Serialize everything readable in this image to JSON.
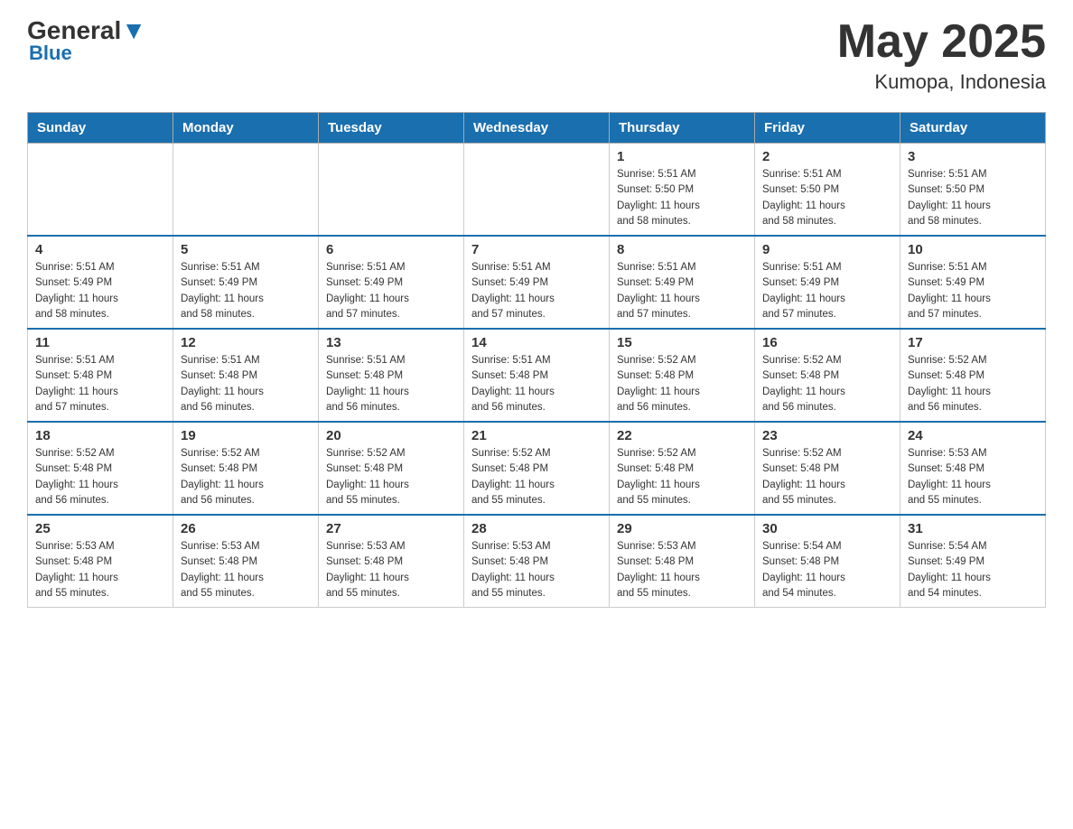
{
  "header": {
    "logo": {
      "general": "General",
      "blue": "Blue"
    },
    "title": "May 2025",
    "subtitle": "Kumopa, Indonesia"
  },
  "days_of_week": [
    "Sunday",
    "Monday",
    "Tuesday",
    "Wednesday",
    "Thursday",
    "Friday",
    "Saturday"
  ],
  "weeks": [
    [
      {
        "day": "",
        "info": ""
      },
      {
        "day": "",
        "info": ""
      },
      {
        "day": "",
        "info": ""
      },
      {
        "day": "",
        "info": ""
      },
      {
        "day": "1",
        "info": "Sunrise: 5:51 AM\nSunset: 5:50 PM\nDaylight: 11 hours\nand 58 minutes."
      },
      {
        "day": "2",
        "info": "Sunrise: 5:51 AM\nSunset: 5:50 PM\nDaylight: 11 hours\nand 58 minutes."
      },
      {
        "day": "3",
        "info": "Sunrise: 5:51 AM\nSunset: 5:50 PM\nDaylight: 11 hours\nand 58 minutes."
      }
    ],
    [
      {
        "day": "4",
        "info": "Sunrise: 5:51 AM\nSunset: 5:49 PM\nDaylight: 11 hours\nand 58 minutes."
      },
      {
        "day": "5",
        "info": "Sunrise: 5:51 AM\nSunset: 5:49 PM\nDaylight: 11 hours\nand 58 minutes."
      },
      {
        "day": "6",
        "info": "Sunrise: 5:51 AM\nSunset: 5:49 PM\nDaylight: 11 hours\nand 57 minutes."
      },
      {
        "day": "7",
        "info": "Sunrise: 5:51 AM\nSunset: 5:49 PM\nDaylight: 11 hours\nand 57 minutes."
      },
      {
        "day": "8",
        "info": "Sunrise: 5:51 AM\nSunset: 5:49 PM\nDaylight: 11 hours\nand 57 minutes."
      },
      {
        "day": "9",
        "info": "Sunrise: 5:51 AM\nSunset: 5:49 PM\nDaylight: 11 hours\nand 57 minutes."
      },
      {
        "day": "10",
        "info": "Sunrise: 5:51 AM\nSunset: 5:49 PM\nDaylight: 11 hours\nand 57 minutes."
      }
    ],
    [
      {
        "day": "11",
        "info": "Sunrise: 5:51 AM\nSunset: 5:48 PM\nDaylight: 11 hours\nand 57 minutes."
      },
      {
        "day": "12",
        "info": "Sunrise: 5:51 AM\nSunset: 5:48 PM\nDaylight: 11 hours\nand 56 minutes."
      },
      {
        "day": "13",
        "info": "Sunrise: 5:51 AM\nSunset: 5:48 PM\nDaylight: 11 hours\nand 56 minutes."
      },
      {
        "day": "14",
        "info": "Sunrise: 5:51 AM\nSunset: 5:48 PM\nDaylight: 11 hours\nand 56 minutes."
      },
      {
        "day": "15",
        "info": "Sunrise: 5:52 AM\nSunset: 5:48 PM\nDaylight: 11 hours\nand 56 minutes."
      },
      {
        "day": "16",
        "info": "Sunrise: 5:52 AM\nSunset: 5:48 PM\nDaylight: 11 hours\nand 56 minutes."
      },
      {
        "day": "17",
        "info": "Sunrise: 5:52 AM\nSunset: 5:48 PM\nDaylight: 11 hours\nand 56 minutes."
      }
    ],
    [
      {
        "day": "18",
        "info": "Sunrise: 5:52 AM\nSunset: 5:48 PM\nDaylight: 11 hours\nand 56 minutes."
      },
      {
        "day": "19",
        "info": "Sunrise: 5:52 AM\nSunset: 5:48 PM\nDaylight: 11 hours\nand 56 minutes."
      },
      {
        "day": "20",
        "info": "Sunrise: 5:52 AM\nSunset: 5:48 PM\nDaylight: 11 hours\nand 55 minutes."
      },
      {
        "day": "21",
        "info": "Sunrise: 5:52 AM\nSunset: 5:48 PM\nDaylight: 11 hours\nand 55 minutes."
      },
      {
        "day": "22",
        "info": "Sunrise: 5:52 AM\nSunset: 5:48 PM\nDaylight: 11 hours\nand 55 minutes."
      },
      {
        "day": "23",
        "info": "Sunrise: 5:52 AM\nSunset: 5:48 PM\nDaylight: 11 hours\nand 55 minutes."
      },
      {
        "day": "24",
        "info": "Sunrise: 5:53 AM\nSunset: 5:48 PM\nDaylight: 11 hours\nand 55 minutes."
      }
    ],
    [
      {
        "day": "25",
        "info": "Sunrise: 5:53 AM\nSunset: 5:48 PM\nDaylight: 11 hours\nand 55 minutes."
      },
      {
        "day": "26",
        "info": "Sunrise: 5:53 AM\nSunset: 5:48 PM\nDaylight: 11 hours\nand 55 minutes."
      },
      {
        "day": "27",
        "info": "Sunrise: 5:53 AM\nSunset: 5:48 PM\nDaylight: 11 hours\nand 55 minutes."
      },
      {
        "day": "28",
        "info": "Sunrise: 5:53 AM\nSunset: 5:48 PM\nDaylight: 11 hours\nand 55 minutes."
      },
      {
        "day": "29",
        "info": "Sunrise: 5:53 AM\nSunset: 5:48 PM\nDaylight: 11 hours\nand 55 minutes."
      },
      {
        "day": "30",
        "info": "Sunrise: 5:54 AM\nSunset: 5:48 PM\nDaylight: 11 hours\nand 54 minutes."
      },
      {
        "day": "31",
        "info": "Sunrise: 5:54 AM\nSunset: 5:49 PM\nDaylight: 11 hours\nand 54 minutes."
      }
    ]
  ]
}
